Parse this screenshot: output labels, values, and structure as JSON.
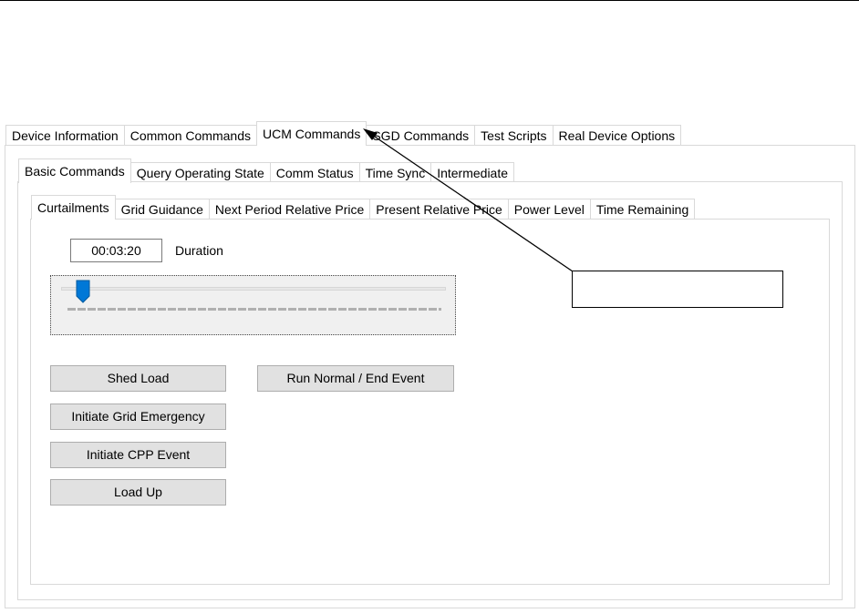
{
  "outer_tabs": {
    "device_information": "Device Information",
    "common_commands": "Common Commands",
    "ucm_commands": "UCM Commands",
    "sgd_commands": "SGD Commands",
    "test_scripts": "Test Scripts",
    "real_device_options": "Real Device Options",
    "active": "UCM Commands"
  },
  "inner_tabs": {
    "basic_commands": "Basic Commands",
    "query_operating_state": "Query Operating State",
    "comm_status": "Comm Status",
    "time_sync": "Time Sync",
    "intermediate": "Intermediate",
    "active": "Basic Commands"
  },
  "sub_tabs": {
    "curtailments": "Curtailments",
    "grid_guidance": "Grid Guidance",
    "next_period_relative_price": "Next Period Relative Price",
    "present_relative_price": "Present Relative Price",
    "power_level": "Power Level",
    "time_remaining": "Time Remaining",
    "active": "Curtailments"
  },
  "curtailments": {
    "duration_value": "00:03:20",
    "duration_label": "Duration",
    "slider_level": 0.04,
    "buttons": {
      "shed_load": "Shed Load",
      "run_normal_end_event": "Run Normal / End Event",
      "initiate_grid_emergency": "Initiate Grid Emergency",
      "initiate_cpp_event": "Initiate CPP Event",
      "load_up": "Load Up"
    }
  },
  "colors": {
    "slider_thumb": "#0078d7",
    "button_face": "#e1e1e1",
    "tab_border": "#d9d9d9"
  }
}
